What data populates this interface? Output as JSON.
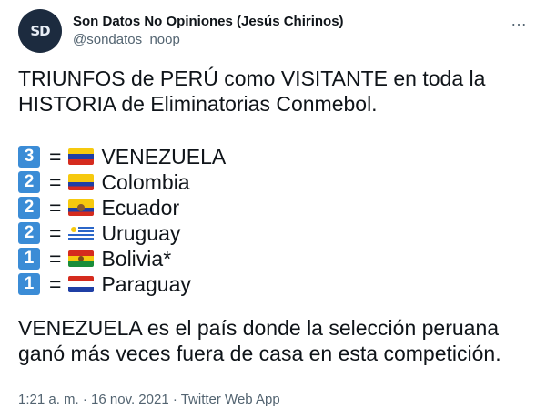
{
  "author": {
    "display_name": "Son Datos No Opiniones (Jesús Chirinos)",
    "handle": "@sondatos_noop",
    "avatar_icon": "sd-logo-avatar"
  },
  "more_icon": "…",
  "text": {
    "intro": "TRIUNFOS de PERÚ como VISITANTE en toda la HISTORIA de Eliminatorias Conmebol.",
    "outro": "VENEZUELA es el país donde la selección peruana ganó más veces fuera de casa en esta competición."
  },
  "list": [
    {
      "count": "3",
      "eq": "=",
      "country": "VENEZUELA",
      "flag": "venezuela-flag"
    },
    {
      "count": "2",
      "eq": "=",
      "country": "Colombia",
      "flag": "colombia-flag"
    },
    {
      "count": "2",
      "eq": "=",
      "country": "Ecuador",
      "flag": "ecuador-flag"
    },
    {
      "count": "2",
      "eq": "=",
      "country": "Uruguay",
      "flag": "uruguay-flag"
    },
    {
      "count": "1",
      "eq": "=",
      "country": "Bolivia*",
      "flag": "bolivia-flag"
    },
    {
      "count": "1",
      "eq": "=",
      "country": "Paraguay",
      "flag": "paraguay-flag"
    }
  ],
  "meta": "1:21 a. m. · 16 nov. 2021 · Twitter Web App",
  "colors": {
    "badge": "#3b8cd6",
    "text": "#0f1419",
    "muted": "#536471"
  }
}
